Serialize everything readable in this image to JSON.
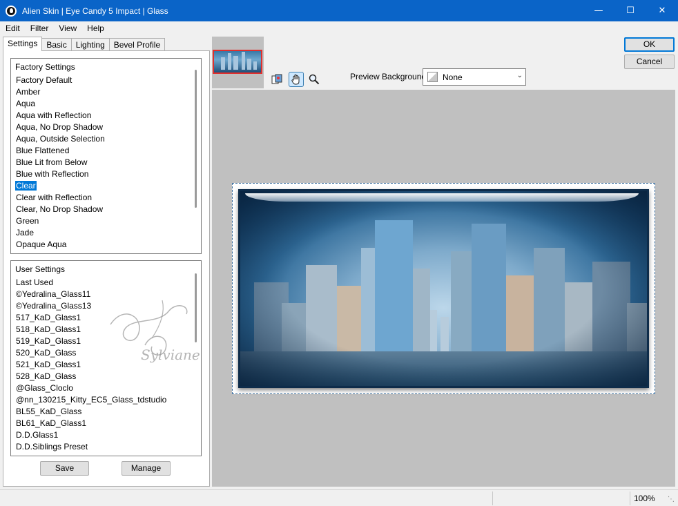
{
  "window": {
    "title": "Alien Skin | Eye Candy 5 Impact | Glass"
  },
  "menu": [
    "Edit",
    "Filter",
    "View",
    "Help"
  ],
  "tabs": [
    "Settings",
    "Basic",
    "Lighting",
    "Bevel Profile"
  ],
  "factory_settings": {
    "header": "Factory Settings",
    "items": [
      "Factory Default",
      "Amber",
      "Aqua",
      "Aqua with Reflection",
      "Aqua, No Drop Shadow",
      "Aqua, Outside Selection",
      "Blue Flattened",
      "Blue Lit from Below",
      "Blue with Reflection",
      "Clear",
      "Clear with Reflection",
      "Clear, No Drop Shadow",
      "Green",
      "Jade",
      "Opaque Aqua"
    ],
    "selected": "Clear"
  },
  "user_settings": {
    "header": "User Settings",
    "items": [
      "Last Used",
      "©Yedralina_Glass11",
      "©Yedralina_Glass13",
      "517_KaD_Glass1",
      "518_KaD_Glass1",
      "519_KaD_Glass1",
      "520_KaD_Glass",
      "521_KaD_Glass1",
      "528_KaD_Glass",
      "@Glass_Cloclo",
      "@nn_130215_Kitty_EC5_Glass_tdstudio",
      "BL55_KaD_Glass",
      "BL61_KaD_Glass1",
      "D.D.Glass1",
      "D.D.Siblings Preset"
    ]
  },
  "buttons": {
    "save": "Save",
    "manage": "Manage",
    "ok": "OK",
    "cancel": "Cancel"
  },
  "preview_background": {
    "label": "Preview Background:",
    "value": "None"
  },
  "watermark": "Sylviane",
  "status": {
    "zoom": "100%"
  },
  "colors": {
    "titlebar": "#0a64c8",
    "selection": "#0078d7",
    "thumb_border": "#e0302e"
  },
  "icons": {
    "tool1": "preview-toggle-icon",
    "tool2": "hand-icon",
    "tool3": "zoom-icon"
  }
}
